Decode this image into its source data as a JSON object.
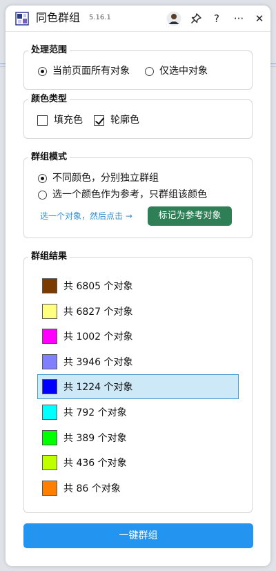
{
  "header": {
    "title": "同色群组",
    "version": "5.16.1",
    "help_label": "?",
    "more_label": "···",
    "close_label": "✕"
  },
  "scope": {
    "title": "处理范围",
    "options": [
      {
        "label": "当前页面所有对象",
        "selected": true
      },
      {
        "label": "仅选中对象",
        "selected": false
      }
    ]
  },
  "color_type": {
    "title": "颜色类型",
    "options": [
      {
        "label": "填充色",
        "checked": false
      },
      {
        "label": "轮廓色",
        "checked": true
      }
    ]
  },
  "group_mode": {
    "title": "群组模式",
    "options": [
      {
        "label": "不同颜色，分别独立群组",
        "selected": true
      },
      {
        "label": "选一个颜色作为参考，只群组该颜色",
        "selected": false
      }
    ],
    "hint": "选一个对象，然后点击 →",
    "mark_button": "标记为参考对象"
  },
  "results": {
    "title": "群组结果",
    "items": [
      {
        "color": "#7a3a00",
        "text": "共 6805 个对象",
        "selected": false
      },
      {
        "color": "#ffff80",
        "text": "共 6827 个对象",
        "selected": false
      },
      {
        "color": "#ff00ff",
        "text": "共 1002 个对象",
        "selected": false
      },
      {
        "color": "#8080ff",
        "text": "共 3946 个对象",
        "selected": false
      },
      {
        "color": "#0000ff",
        "text": "共 1224 个对象",
        "selected": true
      },
      {
        "color": "#00ffff",
        "text": "共 792 个对象",
        "selected": false
      },
      {
        "color": "#00ff00",
        "text": "共 389 个对象",
        "selected": false
      },
      {
        "color": "#c0ff00",
        "text": "共 436 个对象",
        "selected": false
      },
      {
        "color": "#ff7f00",
        "text": "共 86 个对象",
        "selected": false
      }
    ]
  },
  "action": {
    "main_button": "一键群组"
  },
  "colors": {
    "accent": "#2394f0",
    "mark_button": "#2f7f56",
    "hint": "#2f8fd3",
    "selection": "#cde8f6"
  }
}
